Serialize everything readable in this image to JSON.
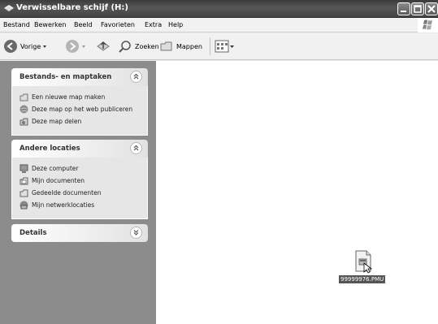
{
  "window": {
    "title": "Verwisselbare schijf (H:)"
  },
  "menubar": {
    "items": [
      {
        "label": "Bestand"
      },
      {
        "label": "Bewerken"
      },
      {
        "label": "Beeld"
      },
      {
        "label": "Favorieten"
      },
      {
        "label": "Extra"
      },
      {
        "label": "Help"
      }
    ]
  },
  "toolbar": {
    "back_label": "Vorige",
    "search_label": "Zoeken",
    "folders_label": "Mappen"
  },
  "taskpane": {
    "panels": [
      {
        "title": "Bestands- en maptaken",
        "items": [
          {
            "label": "Een nieuwe map maken",
            "icon": "new-folder-icon"
          },
          {
            "label": "Deze map op het web publiceren",
            "icon": "globe-icon"
          },
          {
            "label": "Deze map delen",
            "icon": "share-folder-icon"
          }
        ]
      },
      {
        "title": "Andere locaties",
        "items": [
          {
            "label": "Deze computer",
            "icon": "computer-icon"
          },
          {
            "label": "Mijn documenten",
            "icon": "documents-icon"
          },
          {
            "label": "Gedeelde documenten",
            "icon": "shared-folder-icon"
          },
          {
            "label": "Mijn netwerklocaties",
            "icon": "network-icon"
          }
        ]
      },
      {
        "title": "Details",
        "items": []
      }
    ]
  },
  "content": {
    "files": [
      {
        "name": "99999976.PMU",
        "icon": "file-icon"
      }
    ]
  },
  "colors": {
    "titlebar": "#4a4a4a",
    "taskpane": "#8c8c8c",
    "content": "#ffffff"
  }
}
